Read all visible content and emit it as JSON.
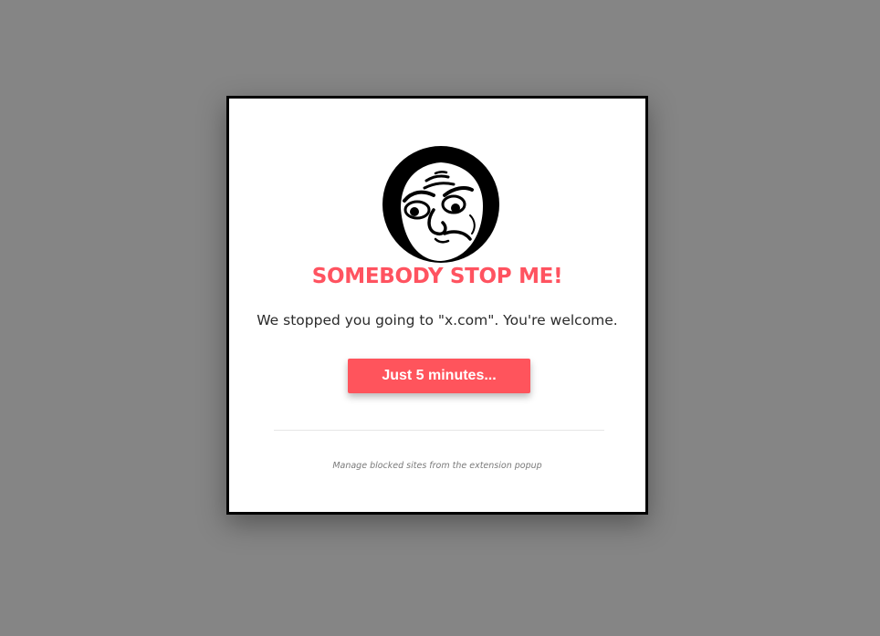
{
  "colors": {
    "backdrop": "#858585",
    "accent": "#ff5360",
    "button_bg": "#ff545c",
    "text": "#2b2b2b",
    "muted": "#7a7a7a"
  },
  "modal": {
    "image_icon": "meme-face-icon",
    "title": "SOMEBODY STOP ME!",
    "message": "We stopped you going to \"x.com\". You're welcome.",
    "button_label": "Just 5 minutes...",
    "footer": "Manage blocked sites from the extension popup"
  }
}
